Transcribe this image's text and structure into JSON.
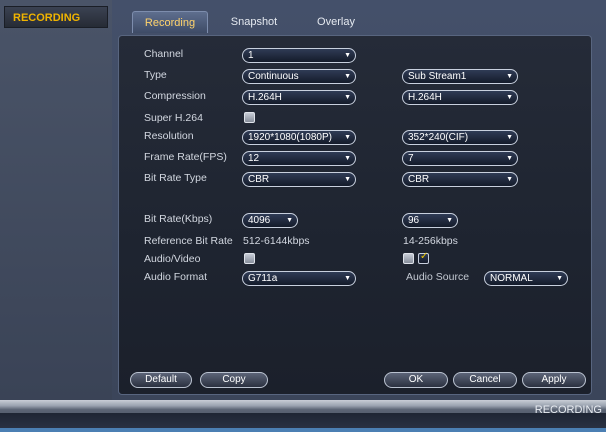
{
  "sidebar": {
    "title": "RECORDING"
  },
  "tabs": [
    {
      "label": "Recording",
      "active": true
    },
    {
      "label": "Snapshot",
      "active": false
    },
    {
      "label": "Overlay",
      "active": false
    }
  ],
  "form": {
    "channel": {
      "label": "Channel",
      "value": "1"
    },
    "type": {
      "label": "Type",
      "main": "Continuous",
      "sub": "Sub Stream1"
    },
    "compression": {
      "label": "Compression",
      "main": "H.264H",
      "sub": "H.264H"
    },
    "super_h264": {
      "label": "Super H.264",
      "checked": false
    },
    "resolution": {
      "label": "Resolution",
      "main": "1920*1080(1080P)",
      "sub": "352*240(CIF)"
    },
    "frame_rate": {
      "label": "Frame Rate(FPS)",
      "main": "12",
      "sub": "7"
    },
    "bit_rate_type": {
      "label": "Bit Rate Type",
      "main": "CBR",
      "sub": "CBR"
    },
    "bit_rate": {
      "label": "Bit Rate(Kbps)",
      "main": "4096",
      "sub": "96"
    },
    "reference_bit_rate": {
      "label": "Reference Bit Rate",
      "main": "512-6144kbps",
      "sub": "14-256kbps"
    },
    "audio_video": {
      "label": "Audio/Video",
      "main_checked": false,
      "sub_checked": false,
      "sub2_checked": true
    },
    "audio_format": {
      "label": "Audio Format",
      "value": "G711a"
    },
    "audio_source": {
      "label": "Audio Source",
      "value": "NORMAL"
    }
  },
  "buttons": {
    "default": "Default",
    "copy": "Copy",
    "ok": "OK",
    "cancel": "Cancel",
    "apply": "Apply"
  },
  "footer": {
    "label": "RECORDING"
  },
  "colors": {
    "accent": "#f0b400",
    "panel": "#1e2430",
    "check": "#f0c800"
  }
}
